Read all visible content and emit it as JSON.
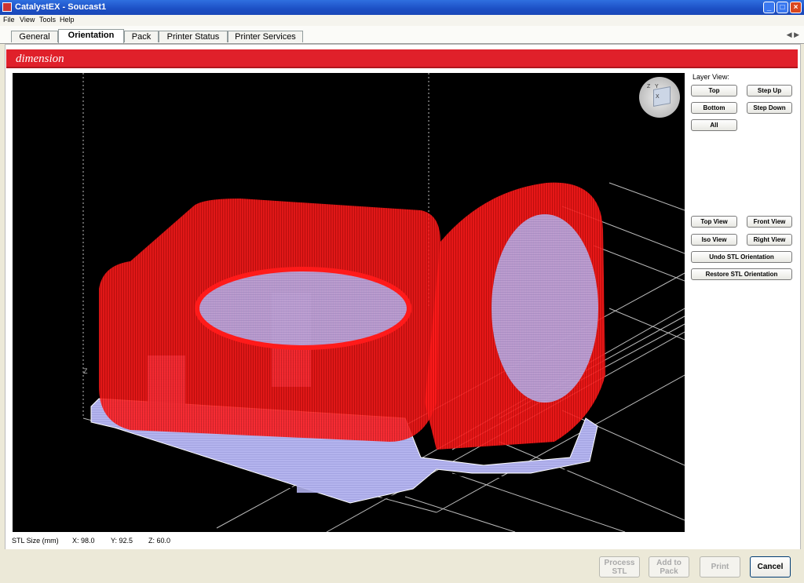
{
  "window": {
    "title": "CatalystEX - Soucast1"
  },
  "menu": [
    "File",
    "View",
    "Tools",
    "Help"
  ],
  "tabs": [
    "General",
    "Orientation",
    "Pack",
    "Printer Status",
    "Printer Services"
  ],
  "active_tab": "Orientation",
  "brand": "dimension",
  "layer_view": {
    "label": "Layer View:",
    "top": "Top",
    "step_up": "Step Up",
    "bottom": "Bottom",
    "step_down": "Step Down",
    "all": "All"
  },
  "view_buttons": {
    "top_view": "Top View",
    "front_view": "Front View",
    "iso_view": "Iso View",
    "right_view": "Right View",
    "undo": "Undo STL Orientation",
    "restore": "Restore STL Orientation"
  },
  "stl_size": {
    "label": "STL Size (mm)",
    "x": "X: 98.0",
    "y": "Y: 92.5",
    "z": "Z: 60.0"
  },
  "axis_z_label": "Z",
  "cube_labels": {
    "x": "X",
    "y": "Y",
    "z": "Z"
  },
  "footer": {
    "process_stl": "Process STL",
    "add_to_pack": "Add to Pack",
    "print": "Print",
    "cancel": "Cancel"
  },
  "colors": {
    "brand_red": "#e0202a",
    "model_red": "#ff1a1a",
    "support_lavender": "#b4b4ee"
  }
}
